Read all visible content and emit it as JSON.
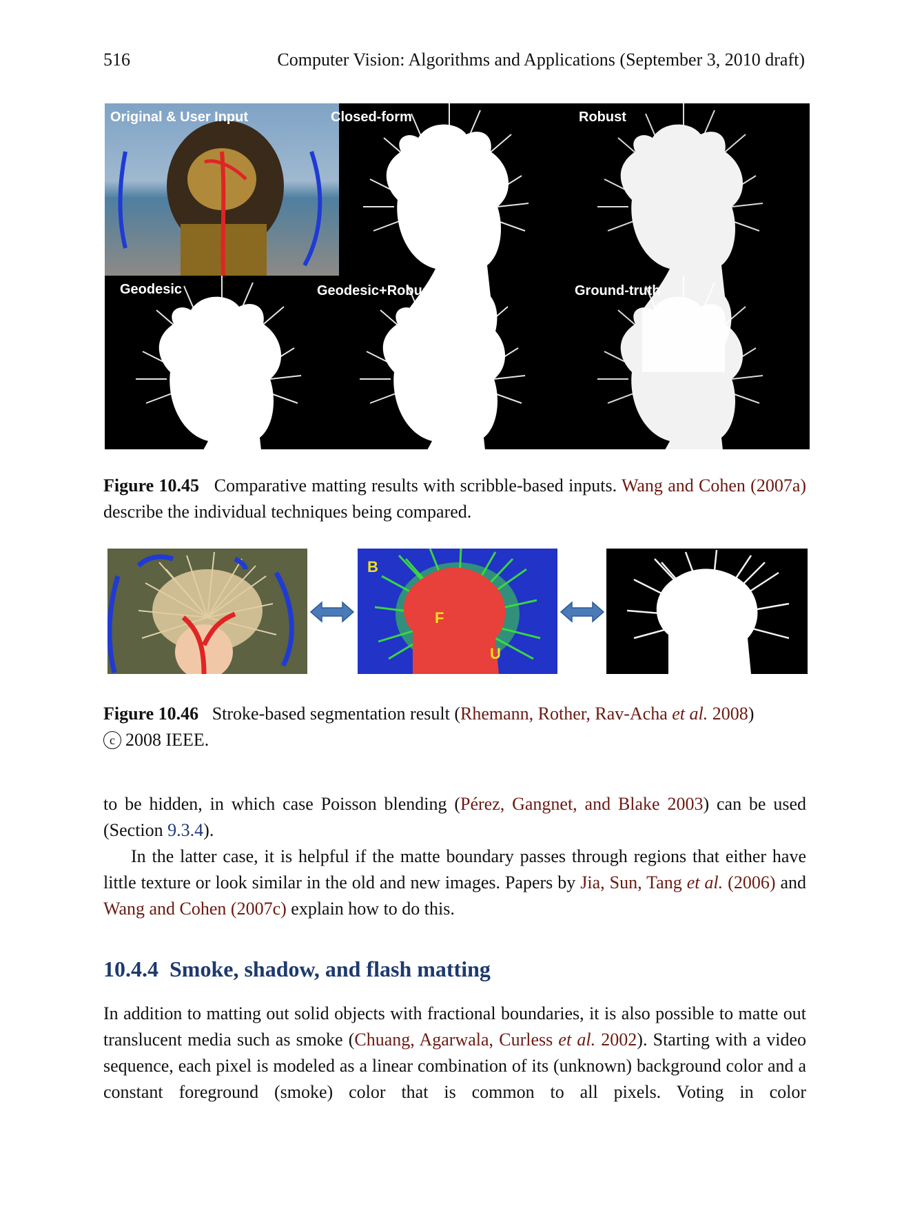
{
  "header": {
    "page_number": "516",
    "running_title": "Computer Vision: Algorithms and Applications (September 3, 2010 draft)"
  },
  "figure_10_45": {
    "panel_labels": [
      "Original & User Input",
      "Closed-form",
      "Robust",
      "Geodesic",
      "Geodesic+Robust",
      "Ground-truth"
    ],
    "caption_label": "Figure 10.45",
    "caption_text_1": "Comparative matting results with scribble-based inputs.",
    "caption_link": "Wang and Cohen",
    "caption_year": "(2007a)",
    "caption_text_2": "describe the individual techniques being compared."
  },
  "figure_10_46": {
    "region_labels": [
      "B",
      "F",
      "U"
    ],
    "caption_label": "Figure 10.46",
    "caption_text_1": "Stroke-based segmentation result (",
    "caption_link": "Rhemann, Rother, Rav-Acha",
    "caption_etal": "et al.",
    "caption_year": "2008",
    "caption_close": ")",
    "copyright_symbol": "c",
    "caption_text_2": "2008 IEEE."
  },
  "paragraph_1": {
    "t1": "to be hidden, in which case Poisson blending (",
    "link": "Pérez, Gangnet, and Blake 2003",
    "t2": ") can be used (Section ",
    "xref": "9.3.4",
    "t3": ")."
  },
  "paragraph_2": {
    "t1": "In the latter case, it is helpful if the matte boundary passes through regions that either have little texture or look similar in the old and new images. Papers by ",
    "link1": "Jia, Sun, Tang",
    "etal": "et al.",
    "year1": "(2006)",
    "t2": " and ",
    "link2": "Wang and Cohen",
    "year2": "(2007c)",
    "t3": " explain how to do this."
  },
  "section": {
    "number": "10.4.4",
    "title": "Smoke, shadow, and flash matting"
  },
  "paragraph_3": {
    "t1": "In addition to matting out solid objects with fractional boundaries, it is also possible to matte out translucent media such as smoke (",
    "link": "Chuang, Agarwala, Curless",
    "etal": "et al.",
    "year": "2002",
    "t2": "). Starting with a video sequence, each pixel is modeled as a linear combination of its (unknown) background color and a constant foreground (smoke) color that is common to all pixels. Voting in color"
  },
  "colors": {
    "link": "#6b1a12",
    "xref": "#1d3a7a",
    "section_heading": "#1d3a6e"
  }
}
